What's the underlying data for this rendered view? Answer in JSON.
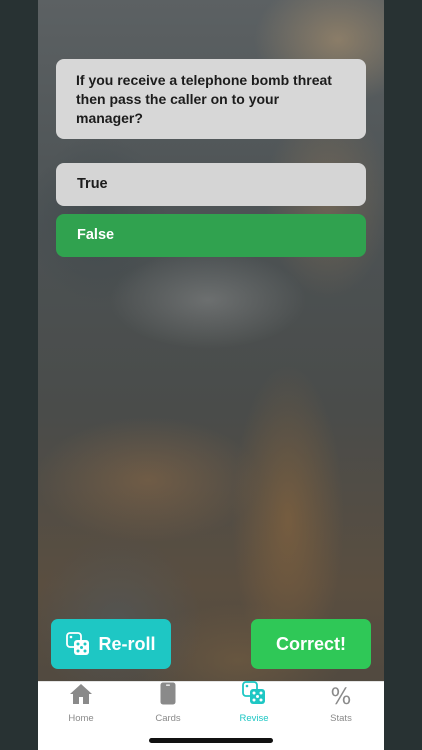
{
  "question": {
    "text": "If you receive a telephone bomb threat then pass the caller on to your manager?"
  },
  "options": [
    {
      "label": "True",
      "state": "unselected"
    },
    {
      "label": "False",
      "state": "correct"
    }
  ],
  "actions": {
    "reroll_label": "Re-roll",
    "correct_label": "Correct!"
  },
  "tabbar": {
    "items": [
      {
        "label": "Home",
        "icon": "home-icon"
      },
      {
        "label": "Cards",
        "icon": "card-icon"
      },
      {
        "label": "Revise",
        "icon": "dice-icon",
        "active": true
      },
      {
        "label": "Stats",
        "icon": "percent-icon",
        "glyph": "%"
      }
    ]
  },
  "colors": {
    "accent": "#1ec7c4",
    "correct_green": "#2fc857",
    "selected_answer_green": "#30a24f"
  }
}
